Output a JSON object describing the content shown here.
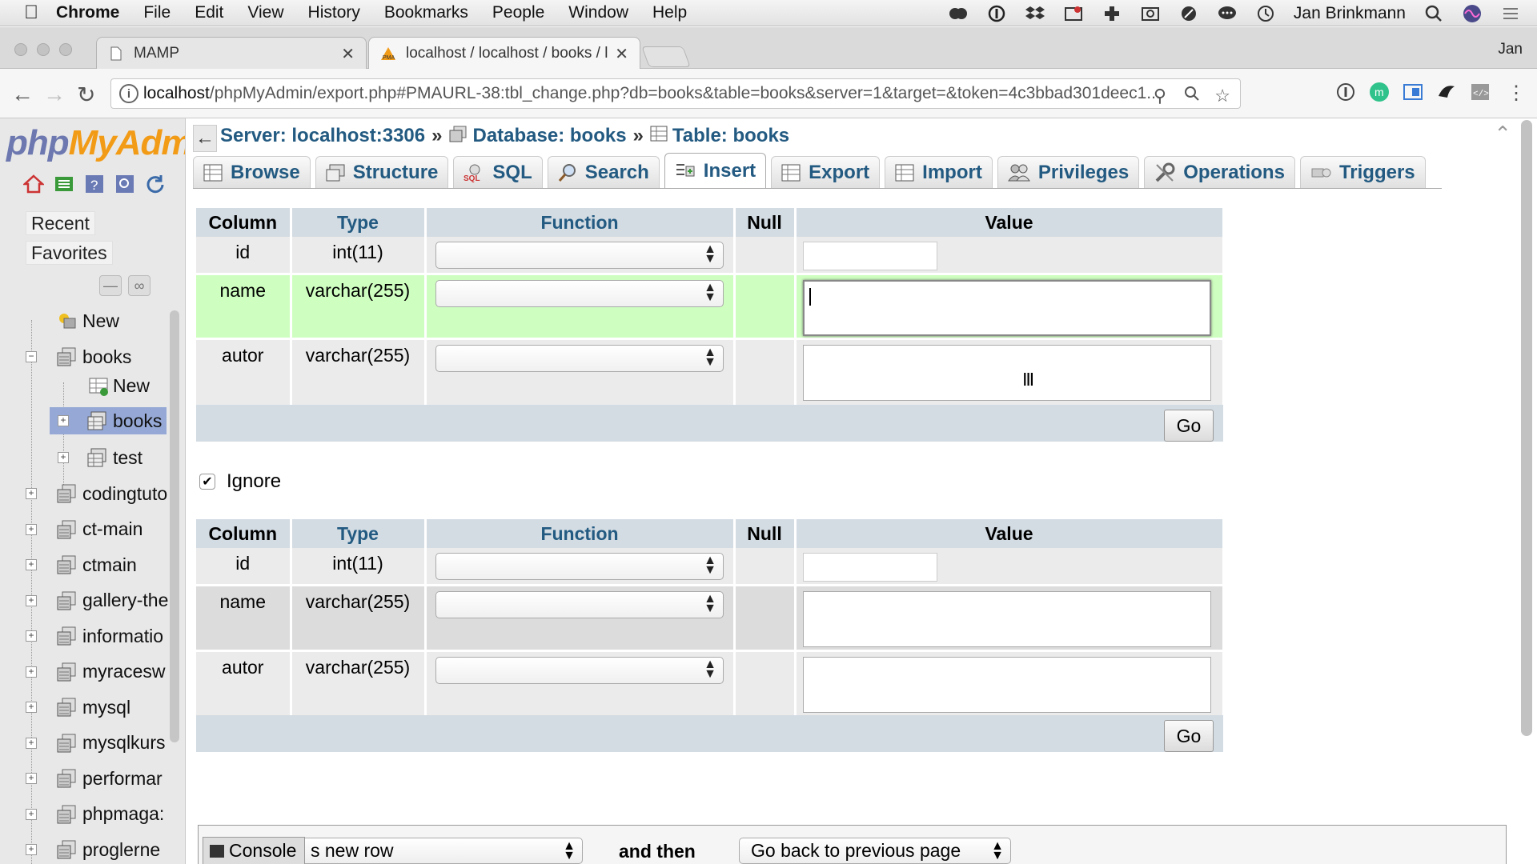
{
  "menubar": {
    "app": "Chrome",
    "items": [
      "File",
      "Edit",
      "View",
      "History",
      "Bookmarks",
      "People",
      "Window",
      "Help"
    ],
    "user": "Jan Brinkmann"
  },
  "browser": {
    "tabs": [
      {
        "title": "MAMP"
      },
      {
        "title": "localhost / localhost / books / l"
      }
    ],
    "profile": "Jan",
    "url_host": "localhost",
    "url_rest": "/phpMyAdmin/export.php#PMAURL-38:tbl_change.php?db=books&table=books&server=1&target=&token=4c3bbad301deec1..."
  },
  "sidebar": {
    "logo_php": "php",
    "logo_my": "MyAdmi",
    "recent": "Recent",
    "favorites": "Favorites",
    "tree": {
      "new_top": "New",
      "books_db": "books",
      "books_new": "New",
      "books_table": "books",
      "test_table": "test",
      "dbs": [
        "codingtuto",
        "ct-main",
        "ctmain",
        "gallery-the",
        "informatio",
        "myracesw",
        "mysql",
        "mysqlkurs",
        "performar",
        "phpmaga:",
        "proglerne"
      ]
    }
  },
  "breadcrumb": {
    "server": "Server: localhost:3306",
    "database": "Database: books",
    "table": "Table: books",
    "sep": "»"
  },
  "tabs": [
    {
      "label": "Browse"
    },
    {
      "label": "Structure"
    },
    {
      "label": "SQL"
    },
    {
      "label": "Search"
    },
    {
      "label": "Insert"
    },
    {
      "label": "Export"
    },
    {
      "label": "Import"
    },
    {
      "label": "Privileges"
    },
    {
      "label": "Operations"
    },
    {
      "label": "Triggers"
    }
  ],
  "table_headers": {
    "column": "Column",
    "type": "Type",
    "function": "Function",
    "null": "Null",
    "value": "Value"
  },
  "rows": [
    {
      "column": "id",
      "type": "int(11)"
    },
    {
      "column": "name",
      "type": "varchar(255)"
    },
    {
      "column": "autor",
      "type": "varchar(255)"
    }
  ],
  "go_label": "Go",
  "ignore_label": "Ignore",
  "footer": {
    "console": "Console",
    "insert_as": "s new row",
    "and_then": "and then",
    "go_back": "Go back to previous page"
  }
}
